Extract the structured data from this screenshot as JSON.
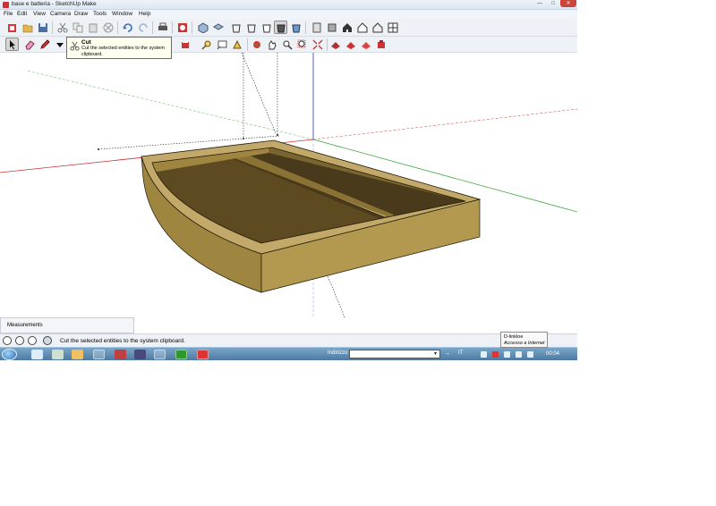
{
  "window": {
    "title": "base e batteria - SketchUp Make"
  },
  "menu": [
    "File",
    "Edit",
    "View",
    "Camera",
    "Draw",
    "Tools",
    "Window",
    "Help"
  ],
  "tooltip": {
    "title": "Cut",
    "description": "Cut the selected entities to the system clipboard."
  },
  "measurements": {
    "label": "Measurements"
  },
  "status": {
    "text": "Cut the selected entities to the system clipboard."
  },
  "network_tooltip": {
    "name": "D-linkloe",
    "status": "Accesso a Internet"
  },
  "taskbar": {
    "address_label": "Indirizzo",
    "address_value": "",
    "language": "IT",
    "clock": "00:04"
  },
  "colors": {
    "axis_red": "#c83232",
    "axis_green": "#3aa83a",
    "axis_blue": "#2e35c8",
    "wood_top": "#c2a96a",
    "wood_side": "#9e8540",
    "wood_dark": "#5e4a20",
    "wood_floor": "#4a3a1c"
  }
}
